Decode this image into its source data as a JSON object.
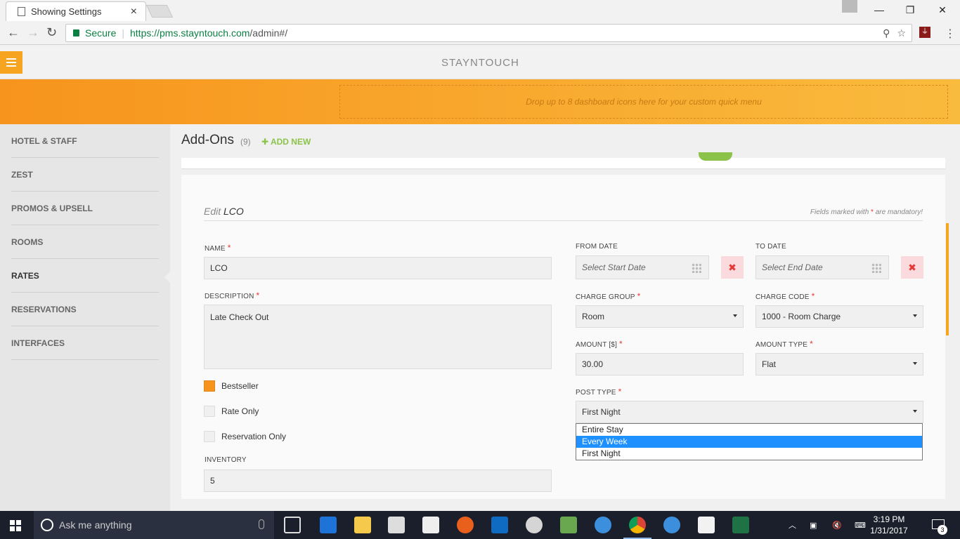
{
  "browser": {
    "tab_title": "Showing Settings",
    "secure_label": "Secure",
    "url_host": "https://pms.stayntouch.com",
    "url_path": "/admin#/"
  },
  "app": {
    "logo_text": "STAYNTOUCH",
    "quick_menu_hint": "Drop up to 8 dashboard icons here for your custom quick menu"
  },
  "sidebar": {
    "items": [
      {
        "label": "HOTEL & STAFF"
      },
      {
        "label": "ZEST"
      },
      {
        "label": "PROMOS & UPSELL"
      },
      {
        "label": "ROOMS"
      },
      {
        "label": "RATES"
      },
      {
        "label": "RESERVATIONS"
      },
      {
        "label": "INTERFACES"
      }
    ],
    "active": "RATES"
  },
  "page": {
    "title": "Add-Ons",
    "count": "(9)",
    "add_new": "ADD NEW"
  },
  "form": {
    "edit_prefix": "Edit",
    "edit_name": "LCO",
    "mandatory_note_pre": "Fields marked with",
    "mandatory_note_post": "are mandatory!",
    "req_mark": "*",
    "name_label": "NAME",
    "name_value": "LCO",
    "description_label": "DESCRIPTION",
    "description_value": "Late Check Out",
    "bestseller_label": "Bestseller",
    "bestseller_checked": true,
    "rate_only_label": "Rate Only",
    "rate_only_checked": false,
    "reservation_only_label": "Reservation Only",
    "reservation_only_checked": false,
    "inventory_label": "INVENTORY",
    "inventory_value": "5",
    "from_date_label": "FROM DATE",
    "from_date_placeholder": "Select Start Date",
    "to_date_label": "TO DATE",
    "to_date_placeholder": "Select End Date",
    "clear_glyph": "✖",
    "charge_group_label": "CHARGE GROUP",
    "charge_group_value": "Room",
    "charge_code_label": "CHARGE CODE",
    "charge_code_value": "1000 - Room Charge",
    "amount_label": "AMOUNT [$]",
    "amount_value": "30.00",
    "amount_type_label": "AMOUNT TYPE",
    "amount_type_value": "Flat",
    "post_type_label": "POST TYPE",
    "post_type_value": "First Night",
    "post_type_options": [
      "Entire Stay",
      "Every Week",
      "First Night"
    ],
    "post_type_highlighted": "Every Week"
  },
  "taskbar": {
    "search_placeholder": "Ask me anything",
    "time": "3:19 PM",
    "date": "1/31/2017",
    "notification_count": "3"
  },
  "colors": {
    "accent_orange": "#f7941d",
    "add_new_green": "#8bc34a",
    "required_red": "#e53935",
    "dropdown_highlight": "#1e90ff"
  }
}
